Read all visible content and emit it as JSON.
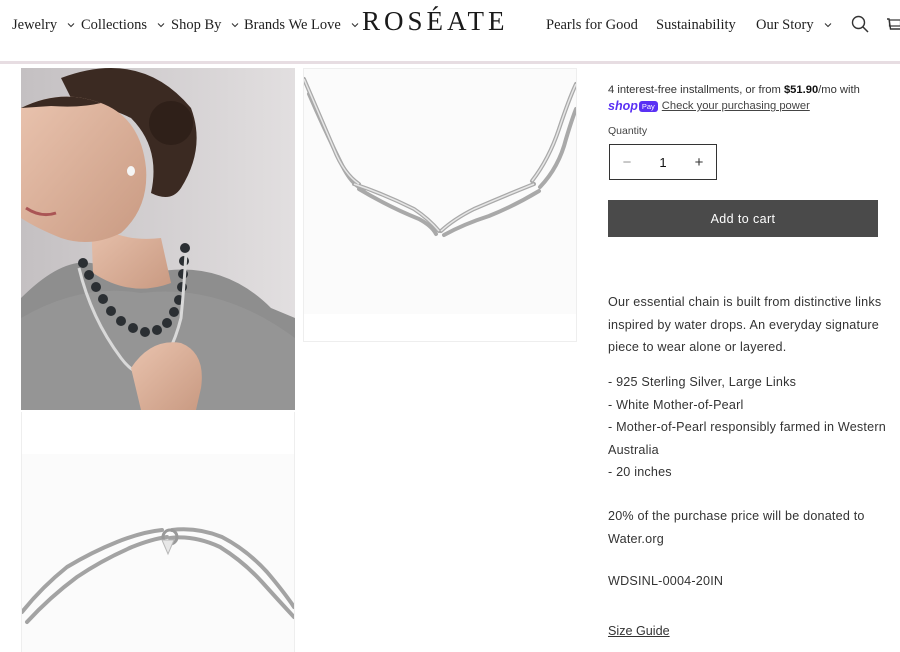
{
  "nav": {
    "left": [
      {
        "label": "Jewelry"
      },
      {
        "label": "Collections"
      },
      {
        "label": "Shop By"
      },
      {
        "label": "Brands We Love"
      }
    ],
    "logo": "ROSÉATE",
    "right": [
      {
        "label": "Pearls for Good"
      },
      {
        "label": "Sustainability"
      },
      {
        "label": "Our Story"
      }
    ],
    "icons": [
      "search-icon",
      "cart-icon"
    ]
  },
  "gallery": {
    "images": [
      {
        "name": "model-wearing-necklace"
      },
      {
        "name": "silver-chain-front"
      },
      {
        "name": "silver-chain-clasp"
      }
    ]
  },
  "product": {
    "installments_prefix": "4 interest-free installments, or from ",
    "installments_amount": "$51.90",
    "installments_suffix": "/mo with",
    "shop_logo": "shop",
    "shop_pay_badge": "Pay",
    "shop_link": "Check your purchasing power",
    "quantity_label": "Quantity",
    "quantity_value": "1",
    "minus_label": "−",
    "plus_label": "+",
    "add_to_cart": "Add to cart",
    "description": "Our essential chain is built from distinctive links inspired by water drops. An everyday signature piece to wear alone or layered.",
    "features": [
      "- 925 Sterling Silver, Large Links",
      "- White Mother-of-Pearl",
      "- Mother-of-Pearl responsibly farmed in Western Australia",
      "- 20 inches"
    ],
    "donation": "20% of the purchase price will be donated to Water.org",
    "sku": "WDSINL-0004-20IN",
    "size_guide": "Size Guide"
  },
  "colors": {
    "button_bg": "#4a4a4a",
    "shop_purple": "#5a31f4",
    "header_line": "#e7dde2"
  }
}
